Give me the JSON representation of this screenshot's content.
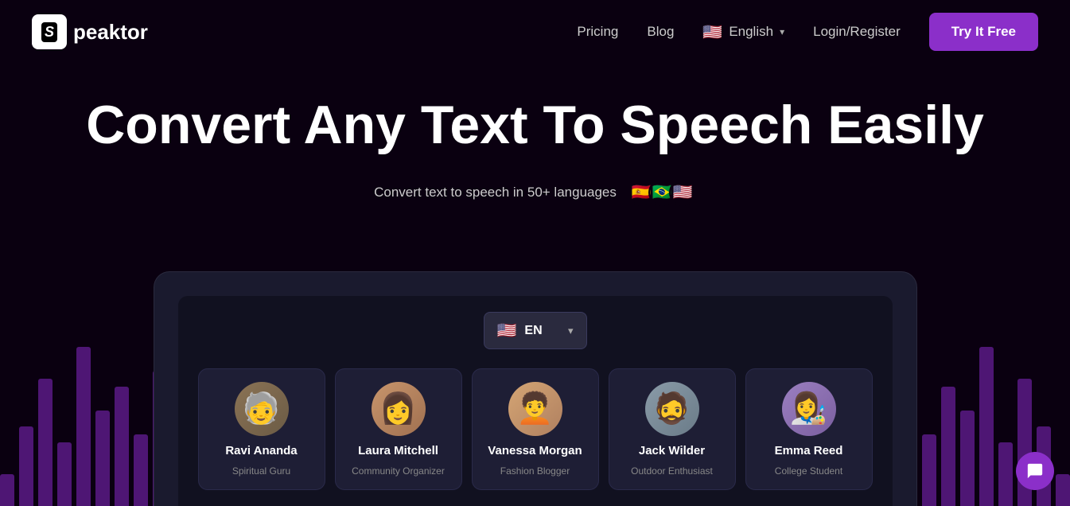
{
  "navbar": {
    "logo_icon": "S",
    "logo_text": "peaktor",
    "links": [
      {
        "label": "Pricing",
        "key": "pricing"
      },
      {
        "label": "Blog",
        "key": "blog"
      }
    ],
    "language": {
      "flag": "🇺🇸",
      "label": "English"
    },
    "login_label": "Login/Register",
    "try_label": "Try It Free"
  },
  "hero": {
    "title": "Convert Any Text To Speech Easily",
    "subtitle": "Convert text to speech in 50+ languages",
    "flags": [
      "🇪🇸",
      "🇧🇷",
      "🇺🇸"
    ]
  },
  "app": {
    "lang_code": "EN",
    "lang_flag": "🇺🇸"
  },
  "voices": [
    {
      "name": "Ravi Ananda",
      "role": "Spiritual Guru",
      "key": "ravi",
      "emoji": "🧓"
    },
    {
      "name": "Laura Mitchell",
      "role": "Community Organizer",
      "key": "laura",
      "emoji": "👩"
    },
    {
      "name": "Vanessa Morgan",
      "role": "Fashion Blogger",
      "key": "vanessa",
      "emoji": "👩‍🦱"
    },
    {
      "name": "Jack Wilder",
      "role": "Outdoor Enthusiast",
      "key": "jack",
      "emoji": "🧔"
    },
    {
      "name": "Emma Reed",
      "role": "College Student",
      "key": "emma",
      "emoji": "👩‍🦰"
    }
  ],
  "waveform": {
    "left_bars": [
      30,
      80,
      120,
      60,
      150,
      90,
      110,
      70,
      130,
      50
    ],
    "right_bars": [
      30,
      80,
      120,
      60,
      150,
      90,
      110,
      70,
      130,
      50
    ]
  }
}
